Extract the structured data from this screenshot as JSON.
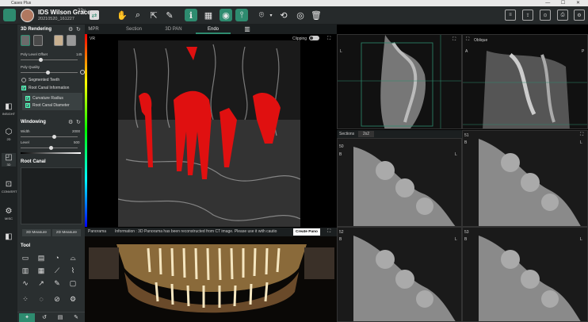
{
  "window": {
    "title": "Cases Plus",
    "controls": "— ☐ ✕"
  },
  "patient": {
    "name": "IDS Wilson Grace",
    "age": "22y",
    "id": "20210520_161227"
  },
  "toolbar": {
    "icons": [
      "hand-icon",
      "magnifier-icon",
      "cursor-icon",
      "pencil-icon",
      "info-icon",
      "grid-icon",
      "eye-icon",
      "levels-icon",
      "camera-icon",
      "refresh-settings-icon",
      "eye-settings-icon",
      "trash-icon"
    ]
  },
  "tabs": [
    {
      "label": "MPR"
    },
    {
      "label": "Section"
    },
    {
      "label": "3D PAN"
    },
    {
      "label": "Endo",
      "active": true
    }
  ],
  "leftbar": [
    {
      "icon": "◧",
      "label": "INSIGHT"
    },
    {
      "icon": "⬡",
      "label": "2D"
    },
    {
      "icon": "◰",
      "label": "3D",
      "active": true
    },
    {
      "icon": "⊡",
      "label": "CONVERT"
    },
    {
      "icon": "⚙",
      "label": "MISC"
    },
    {
      "icon": "◧",
      "label": ""
    }
  ],
  "rendering": {
    "title": "3D Rendering",
    "sliders": [
      {
        "label": "Poly Level Offset",
        "value": "145",
        "pos": 0.3
      },
      {
        "label": "Poly Quality",
        "value": "",
        "pos": 0.45
      }
    ],
    "segmented": "Segmented Teeth",
    "root_canal_info": "Root Canal Information",
    "curvature": "Curvature Radius",
    "diameter": "Root Canal Diameter"
  },
  "windowing": {
    "title": "Windowing",
    "sliders": [
      {
        "label": "Width",
        "value": "2000",
        "pos": 0.55
      },
      {
        "label": "Level",
        "value": "500",
        "pos": 0.5
      }
    ]
  },
  "root_canal": {
    "title": "Root Canal",
    "btn3d": "3D Measure",
    "btn2d": "2D Measure"
  },
  "tool": {
    "title": "Tool"
  },
  "viewports": {
    "vr_label": "VR",
    "clipping": "Clipping",
    "oblique": "Oblique",
    "sections": "Sections",
    "layout": "2x2"
  },
  "info": {
    "panorama": "Panorama",
    "message": "Information : 3D Panorama has been reconstructed from CT image. Please use it with cautio",
    "create": "Create Pano"
  },
  "slices": [
    {
      "n": "50",
      "s": "B",
      "l": "L"
    },
    {
      "n": "51",
      "s": "B",
      "l": "L"
    },
    {
      "n": "52",
      "s": "B",
      "l": "L"
    },
    {
      "n": "53",
      "s": "B",
      "l": "L"
    }
  ],
  "colors": {
    "accent": "#2e8b6f",
    "canal": "#e01010"
  }
}
